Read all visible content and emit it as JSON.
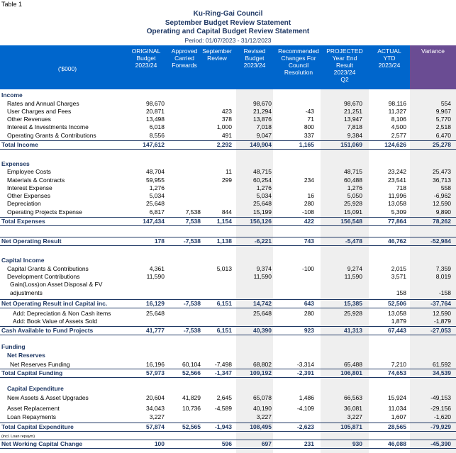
{
  "caption": "Table 1",
  "title_lines": [
    "Ku-Ring-Gai Council",
    "September Budget Review Statement",
    "Operating and Capital Budget Review Statement"
  ],
  "period": "Period: 01/07/2023 - 31/12/2023",
  "columns": [
    "ORIGINAL\nBudget\n2023/24",
    "Approved\nCarried\nForwards",
    "September\nReview",
    "Revised\nBudget\n2023/24",
    "Recommended\nChanges For\nCouncil\nResolution",
    "PROJECTED\nYear End\nResult\n2023/24\nQ2",
    "ACTUAL\nYTD\n2023/24",
    "Variance"
  ],
  "unit_label": "('$000)",
  "rows": [
    {
      "type": "section",
      "label": "Income"
    },
    {
      "type": "item",
      "label": "Rates and Annual Charges",
      "values": [
        "98,670",
        "",
        "",
        "98,670",
        "",
        "98,670",
        "98,116",
        "554"
      ]
    },
    {
      "type": "item",
      "label": "User Charges and Fees",
      "values": [
        "20,871",
        "",
        "423",
        "21,294",
        "-43",
        "21,251",
        "11,327",
        "9,967"
      ]
    },
    {
      "type": "item",
      "label": "Other Revenues",
      "values": [
        "13,498",
        "",
        "378",
        "13,876",
        "71",
        "13,947",
        "8,106",
        "5,770"
      ]
    },
    {
      "type": "item",
      "label": "Interest & Investments Income",
      "values": [
        "6,018",
        "",
        "1,000",
        "7,018",
        "800",
        "7,818",
        "4,500",
        "2,518"
      ]
    },
    {
      "type": "item",
      "label": "Operating Grants & Contributions",
      "values": [
        "8,556",
        "",
        "491",
        "9,047",
        "337",
        "9,384",
        "2,577",
        "6,470"
      ]
    },
    {
      "type": "total",
      "label": "Total Income",
      "values": [
        "147,612",
        "",
        "2,292",
        "149,904",
        "1,165",
        "151,069",
        "124,626",
        "25,278"
      ]
    },
    {
      "type": "section",
      "label": "Expenses"
    },
    {
      "type": "item",
      "label": "Employee Costs",
      "values": [
        "48,704",
        "",
        "11",
        "48,715",
        "",
        "48,715",
        "23,242",
        "25,473"
      ]
    },
    {
      "type": "item",
      "label": "Materials & Contracts",
      "values": [
        "59,955",
        "",
        "299",
        "60,254",
        "234",
        "60,488",
        "23,541",
        "36,713"
      ]
    },
    {
      "type": "item",
      "label": "Interest Expense",
      "values": [
        "1,276",
        "",
        "",
        "1,276",
        "",
        "1,276",
        "718",
        "558"
      ]
    },
    {
      "type": "item",
      "label": "Other Expenses",
      "values": [
        "5,034",
        "",
        "",
        "5,034",
        "16",
        "5,050",
        "11,996",
        "-6,962"
      ]
    },
    {
      "type": "item",
      "label": "Depreciation",
      "values": [
        "25,648",
        "",
        "",
        "25,648",
        "280",
        "25,928",
        "13,058",
        "12,590"
      ]
    },
    {
      "type": "item",
      "label": "Operating Projects Expense",
      "values": [
        "6,817",
        "7,538",
        "844",
        "15,199",
        "-108",
        "15,091",
        "5,309",
        "9,890"
      ]
    },
    {
      "type": "total",
      "label": "Total Expenses",
      "values": [
        "147,434",
        "7,538",
        "1,154",
        "156,126",
        "422",
        "156,548",
        "77,864",
        "78,262"
      ]
    },
    {
      "type": "total",
      "label": "Net Operating Result",
      "values": [
        "178",
        "-7,538",
        "1,138",
        "-6,221",
        "743",
        "-5,478",
        "46,762",
        "-52,984"
      ]
    },
    {
      "type": "section",
      "label": "Capital Income"
    },
    {
      "type": "item",
      "label": "Capital Grants & Contributions",
      "values": [
        "4,361",
        "",
        "5,013",
        "9,374",
        "-100",
        "9,274",
        "2,015",
        "7,359"
      ]
    },
    {
      "type": "item",
      "label": "Development Contributions",
      "values": [
        "11,590",
        "",
        "",
        "11,590",
        "",
        "11,590",
        "3,571",
        "8,019"
      ]
    },
    {
      "type": "item",
      "label": "Gain(Loss)on Asset Disposal & FV",
      "values": [
        "",
        "",
        "",
        "",
        "",
        "",
        "",
        ""
      ]
    },
    {
      "type": "item",
      "label": "adjustments",
      "values": [
        "",
        "",
        "",
        "",
        "",
        "",
        "158",
        "-158"
      ]
    },
    {
      "type": "total",
      "label": "Net Operating Result incl Capital inc.",
      "values": [
        "16,129",
        "-7,538",
        "6,151",
        "14,742",
        "643",
        "15,385",
        "52,506",
        "-37,764"
      ]
    },
    {
      "type": "item",
      "label": "Add: Depreciation & Non Cash items",
      "values": [
        "25,648",
        "",
        "",
        "25,648",
        "280",
        "25,928",
        "13,058",
        "12,590"
      ]
    },
    {
      "type": "item",
      "label": "Add: Book Value of Assets Sold",
      "values": [
        "",
        "",
        "",
        "",
        "",
        "",
        "1,879",
        "-1,879"
      ]
    },
    {
      "type": "total",
      "label": "Cash Available to Fund Projects",
      "values": [
        "41,777",
        "-7,538",
        "6,151",
        "40,390",
        "923",
        "41,313",
        "67,443",
        "-27,053"
      ]
    },
    {
      "type": "section",
      "label": "Funding"
    },
    {
      "type": "section",
      "label": "Net Reserves"
    },
    {
      "type": "item",
      "label": "Net Reserves Funding",
      "values": [
        "16,196",
        "60,104",
        "-7,498",
        "68,802",
        "-3,314",
        "65,488",
        "7,210",
        "61,592"
      ]
    },
    {
      "type": "total",
      "label": "Total Capital Funding",
      "values": [
        "57,973",
        "52,566",
        "-1,347",
        "109,192",
        "-2,391",
        "106,801",
        "74,653",
        "34,539"
      ]
    },
    {
      "type": "section",
      "label": "Capital Expenditure"
    },
    {
      "type": "item",
      "label": "New Assets & Asset Upgrades",
      "values": [
        "20,604",
        "41,829",
        "2,645",
        "65,078",
        "1,486",
        "66,563",
        "15,924",
        "-49,153"
      ]
    },
    {
      "type": "item",
      "label": "Asset Replacement",
      "values": [
        "34,043",
        "10,736",
        "-4,589",
        "40,190",
        "-4,109",
        "36,081",
        "11,034",
        "-29,156"
      ]
    },
    {
      "type": "item",
      "label": "Loan Repayments",
      "values": [
        "3,227",
        "",
        "",
        "3,227",
        "",
        "3,227",
        "1,607",
        "-1,620"
      ]
    },
    {
      "type": "total",
      "label": "Total Capital Expenditure",
      "values": [
        "57,874",
        "52,565",
        "-1,943",
        "108,495",
        "-2,623",
        "105,871",
        "28,565",
        "-79,929"
      ]
    },
    {
      "type": "note",
      "label": "(incl. Loan repaym)"
    },
    {
      "type": "total",
      "label": "Net Working Capital Change",
      "values": [
        "100",
        "",
        "596",
        "697",
        "231",
        "930",
        "46,088",
        "-45,390"
      ]
    }
  ]
}
